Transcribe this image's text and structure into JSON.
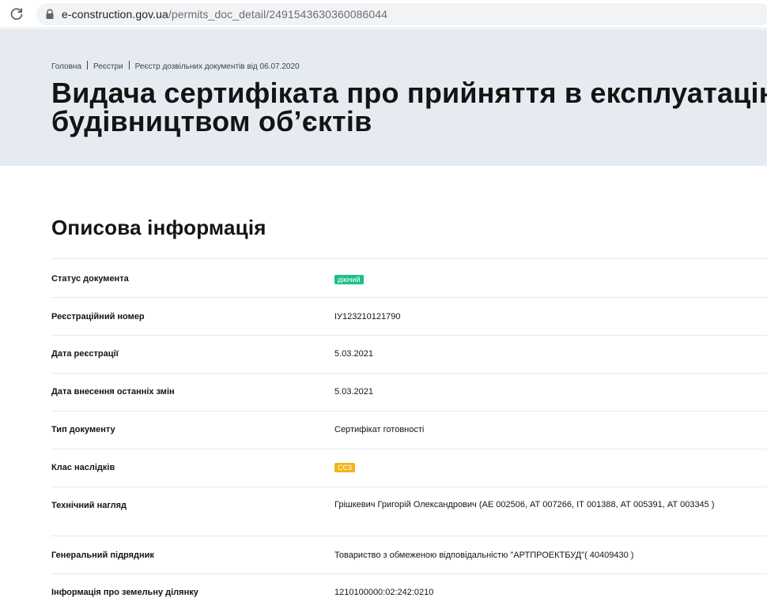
{
  "browser": {
    "url_host": "e-construction.gov.ua",
    "url_path": "/permits_doc_detail/2491543630360086044"
  },
  "breadcrumb": {
    "items": [
      "Головна",
      "Реєстри",
      "Реєстр дозвільних документів від 06.07.2020"
    ]
  },
  "page": {
    "title_line1": "Видача сертифіката про прийняття в експлуатацію",
    "title_line2": "будівництвом об’єктів"
  },
  "section": {
    "title": "Описова інформація"
  },
  "rows": [
    {
      "label": "Статус документа",
      "value": "діючий",
      "badge_color": "#1dbf8c"
    },
    {
      "label": "Реєстраційний номер",
      "value": "ІУ123210121790"
    },
    {
      "label": "Дата реєстрації",
      "value": "5.03.2021"
    },
    {
      "label": "Дата внесення останніх змін",
      "value": "5.03.2021"
    },
    {
      "label": "Тип документу",
      "value": "Сертифікат готовності"
    },
    {
      "label": "Клас наслідків",
      "value": "СС3",
      "badge_color": "#f3b41b"
    },
    {
      "label": "Технічний нагляд",
      "value": "Грішкевич Григорій Олександрович (АЕ 002506, АТ 007266, ІТ 001388, АТ 005391, АТ 003345 )"
    },
    {
      "label": "Генеральний підрядник",
      "value": "Товариство з обмеженою відповідальністю \"АРТПРОЕКТБУД\"( 40409430 )"
    },
    {
      "label": "Інформація про земельну ділянку",
      "value": "1210100000:02:242:0210"
    }
  ],
  "colors": {
    "hero_bg": "#e5ebf1",
    "status_active": "#1dbf8c",
    "class_badge": "#f3b41b"
  },
  "icons": {
    "reload": "reload-icon",
    "lock": "lock-icon"
  }
}
